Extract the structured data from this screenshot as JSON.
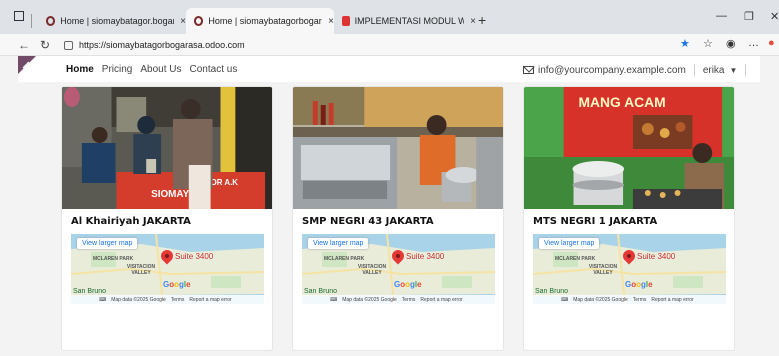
{
  "browser": {
    "tabs": [
      {
        "title": "Home | siomaybatagor.bogarasa",
        "close": "×"
      },
      {
        "title": "Home | siomaybatagorbogarasa",
        "close": "×"
      },
      {
        "title": "IMPLEMENTASI MODUL WEBSITE",
        "close": "×"
      }
    ],
    "new_tab": "+",
    "url": "https://siomaybatagorbogarasa.odoo.com"
  },
  "site": {
    "nav": [
      "Home",
      "Pricing",
      "About Us",
      "Contact us"
    ],
    "email": "info@yourcompany.example.com",
    "user": "erika"
  },
  "cards": [
    {
      "title": "Al Khairiyah JAKARTA"
    },
    {
      "title": "SMP NEGRI 43 JAKARTA"
    },
    {
      "title": "MTS NEGRI 1 JAKARTA"
    }
  ],
  "map": {
    "link": "View larger map",
    "pin_label": "Suite 3400",
    "place1": "MCLAREN PARK",
    "place2": "VISITACION VALLEY",
    "city": "San Bruno",
    "google": "Google",
    "data": "Map data ©2025 Google",
    "terms": "Terms",
    "report": "Report a map error"
  },
  "colors": {
    "accent": "#714b67",
    "map_water": "#a9d3e8",
    "map_land": "#e8ecd9"
  }
}
